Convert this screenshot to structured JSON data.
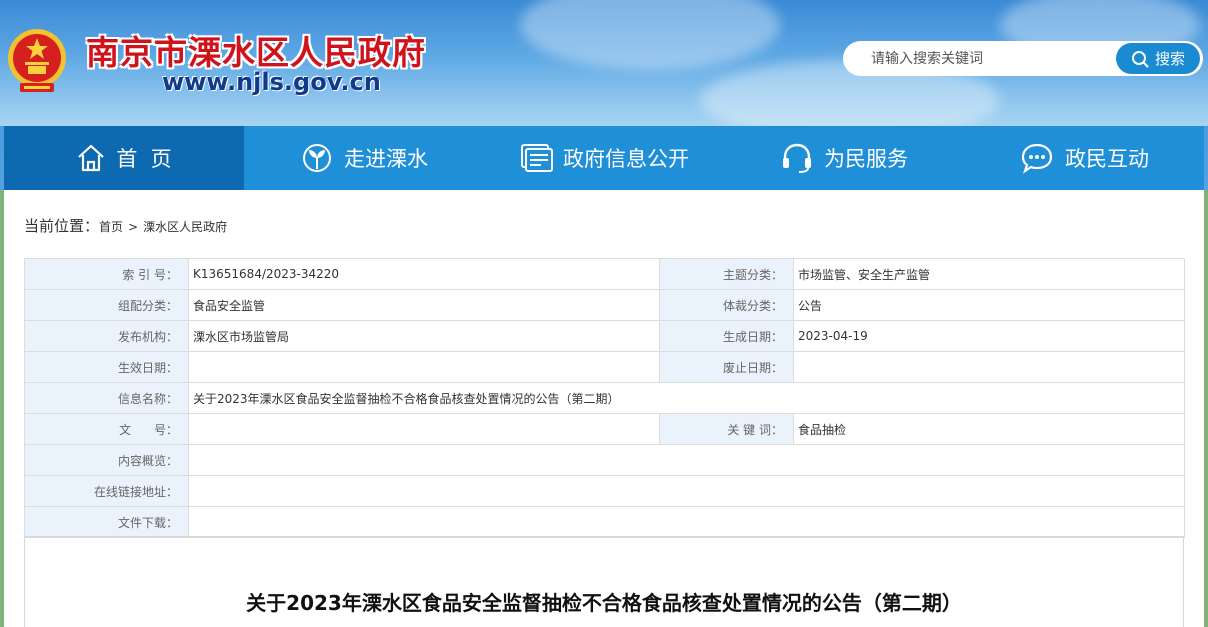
{
  "header": {
    "site_title": "南京市溧水区人民政府",
    "site_url": "www.njls.gov.cn",
    "search_placeholder": "请输入搜索关键词",
    "search_button": "搜索"
  },
  "nav": [
    {
      "label": "首  页",
      "icon": "home-icon",
      "active": true
    },
    {
      "label": "走进溧水",
      "icon": "sprout-icon",
      "active": false
    },
    {
      "label": "政府信息公开",
      "icon": "document-icon",
      "active": false
    },
    {
      "label": "为民服务",
      "icon": "headset-icon",
      "active": false
    },
    {
      "label": "政民互动",
      "icon": "chat-icon",
      "active": false
    }
  ],
  "breadcrumb": {
    "label": "当前位置：",
    "items": [
      "首页",
      "溧水区人民政府"
    ],
    "separator": ">"
  },
  "meta": {
    "index_no_label": "索 引 号：",
    "index_no": "K13651684/2023-34220",
    "topic_label": "主题分类：",
    "topic": "市场监管、安全生产监管",
    "group_label": "组配分类：",
    "group": "食品安全监管",
    "genre_label": "体裁分类：",
    "genre": "公告",
    "issuer_label": "发布机构：",
    "issuer": "溧水区市场监管局",
    "created_label": "生成日期：",
    "created": "2023-04-19",
    "effective_label": "生效日期：",
    "effective": "",
    "abolish_label": "废止日期：",
    "abolish": "",
    "info_name_label": "信息名称：",
    "info_name": "关于2023年溧水区食品安全监督抽检不合格食品核查处置情况的公告（第二期）",
    "doc_no_label": "文      号：",
    "doc_no": "",
    "keyword_label": "关 键 词：",
    "keyword": "食品抽检",
    "summary_label": "内容概览：",
    "summary": "",
    "link_label": "在线链接地址：",
    "link": "",
    "download_label": "文件下载：",
    "download": ""
  },
  "article": {
    "title": "关于2023年溧水区食品安全监督抽检不合格食品核查处置情况的公告（第二期）"
  },
  "colors": {
    "nav_bg": "#1f8fd7",
    "nav_active": "#0d6ab1",
    "title_red": "#d0121b",
    "label_bg": "#eaf2fb"
  }
}
